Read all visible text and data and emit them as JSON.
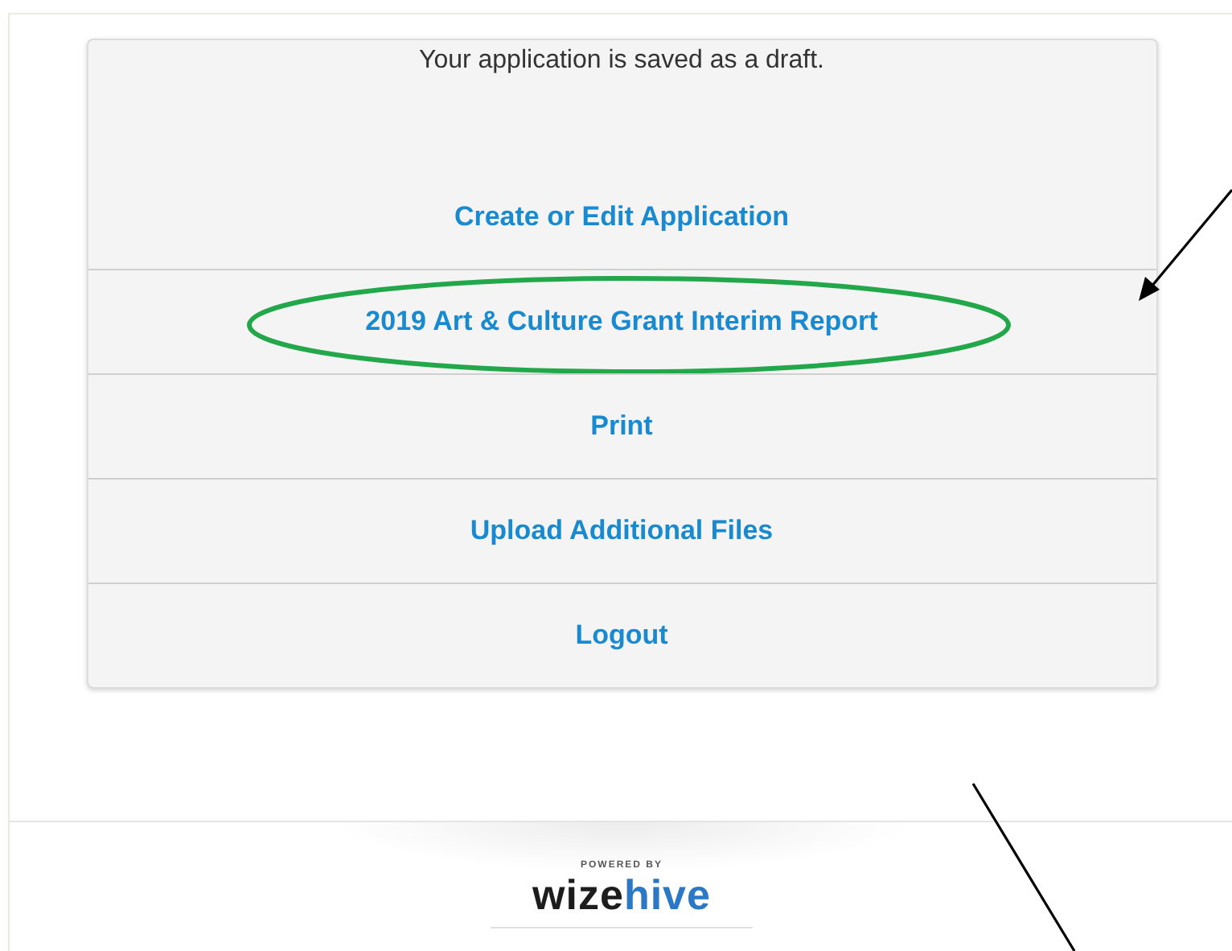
{
  "status_message": "Your application is saved as a draft.",
  "actions": [
    {
      "label": "Create or Edit Application",
      "circled": false
    },
    {
      "label": "2019 Art & Culture Grant Interim Report",
      "circled": true
    },
    {
      "label": "Print",
      "circled": false
    },
    {
      "label": "Upload Additional Files",
      "circled": false
    },
    {
      "label": "Logout",
      "circled": false
    }
  ],
  "footer": {
    "caption": "POWERED BY",
    "logo_parts": [
      "wize",
      "hive"
    ]
  }
}
